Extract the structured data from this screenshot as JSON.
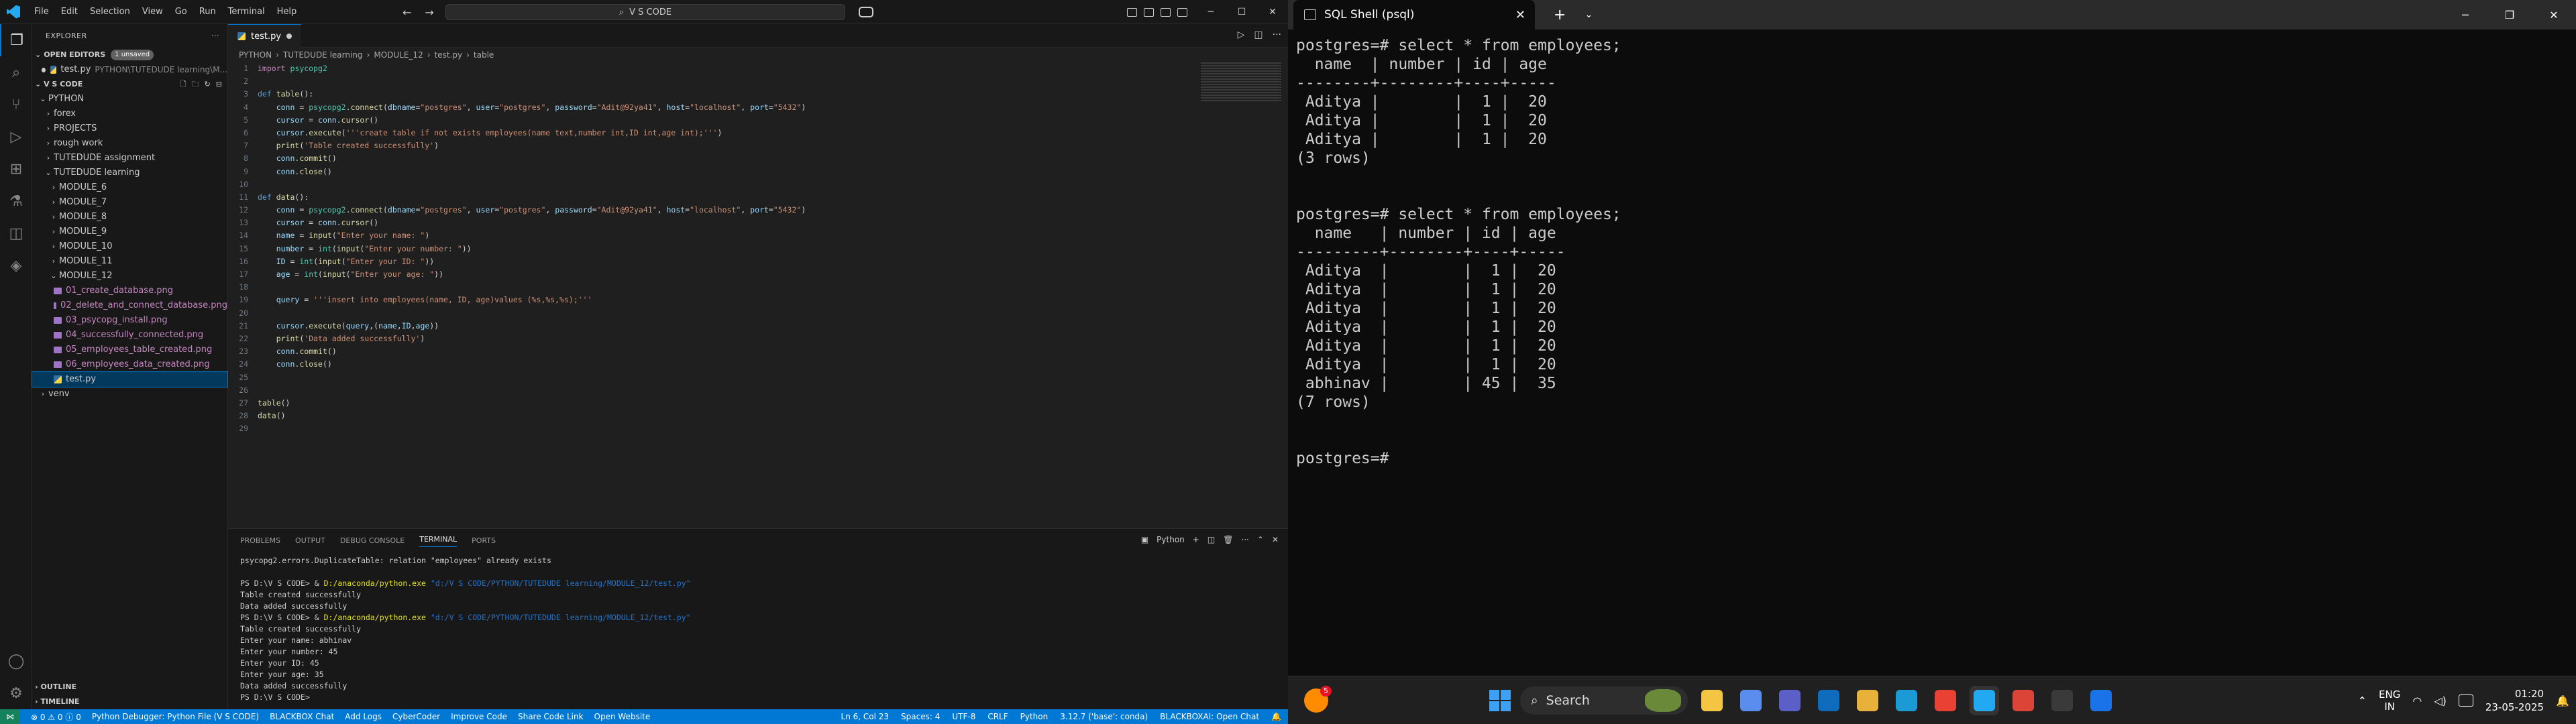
{
  "vscode": {
    "menu": [
      "File",
      "Edit",
      "Selection",
      "View",
      "Go",
      "Run",
      "Terminal",
      "Help"
    ],
    "command_center": "V S CODE",
    "explorer": {
      "title": "EXPLORER",
      "open_editors": "OPEN EDITORS",
      "unsaved_badge": "1 unsaved",
      "open_file": "test.py",
      "open_file_path": "PYTHON\\TUTEDUDE learning\\M...",
      "workspace": "V S CODE",
      "tree": [
        {
          "label": "PYTHON",
          "indent": 1,
          "type": "folder-open"
        },
        {
          "label": "forex",
          "indent": 2,
          "type": "folder"
        },
        {
          "label": "PROJECTS",
          "indent": 2,
          "type": "folder"
        },
        {
          "label": "rough work",
          "indent": 2,
          "type": "folder"
        },
        {
          "label": "TUTEDUDE assignment",
          "indent": 2,
          "type": "folder"
        },
        {
          "label": "TUTEDUDE learning",
          "indent": 2,
          "type": "folder-open"
        },
        {
          "label": "MODULE_6",
          "indent": 3,
          "type": "folder"
        },
        {
          "label": "MODULE_7",
          "indent": 3,
          "type": "folder"
        },
        {
          "label": "MODULE_8",
          "indent": 3,
          "type": "folder"
        },
        {
          "label": "MODULE_9",
          "indent": 3,
          "type": "folder"
        },
        {
          "label": "MODULE_10",
          "indent": 3,
          "type": "folder"
        },
        {
          "label": "MODULE_11",
          "indent": 3,
          "type": "folder"
        },
        {
          "label": "MODULE_12",
          "indent": 3,
          "type": "folder-open"
        },
        {
          "label": "01_create_database.png",
          "indent": 4,
          "type": "image"
        },
        {
          "label": "02_delete_and_connect_database.png",
          "indent": 4,
          "type": "image"
        },
        {
          "label": "03_psycopg_install.png",
          "indent": 4,
          "type": "image"
        },
        {
          "label": "04_successfully_connected.png",
          "indent": 4,
          "type": "image"
        },
        {
          "label": "05_employees_table_created.png",
          "indent": 4,
          "type": "image"
        },
        {
          "label": "06_employees_data_created.png",
          "indent": 4,
          "type": "image"
        },
        {
          "label": "test.py",
          "indent": 4,
          "type": "python",
          "selected": true
        },
        {
          "label": "venv",
          "indent": 1,
          "type": "folder"
        }
      ],
      "outline": "OUTLINE",
      "timeline": "TIMELINE"
    },
    "tab": "test.py",
    "breadcrumb": [
      "PYTHON",
      "TUTEDUDE learning",
      "MODULE_12",
      "test.py",
      "table"
    ],
    "code_lines": [
      [
        [
          "kw",
          "import"
        ],
        [
          "plain",
          " "
        ],
        [
          "cls",
          "psycopg2"
        ]
      ],
      [],
      [
        [
          "def",
          "def"
        ],
        [
          "plain",
          " "
        ],
        [
          "fn",
          "table"
        ],
        [
          "plain",
          "():"
        ]
      ],
      [
        [
          "plain",
          "    "
        ],
        [
          "var",
          "conn"
        ],
        [
          "plain",
          " = "
        ],
        [
          "cls",
          "psycopg2"
        ],
        [
          "plain",
          "."
        ],
        [
          "fn",
          "connect"
        ],
        [
          "plain",
          "("
        ],
        [
          "var",
          "dbname"
        ],
        [
          "plain",
          "="
        ],
        [
          "str",
          "\"postgres\""
        ],
        [
          "plain",
          ", "
        ],
        [
          "var",
          "user"
        ],
        [
          "plain",
          "="
        ],
        [
          "str",
          "\"postgres\""
        ],
        [
          "plain",
          ", "
        ],
        [
          "var",
          "password"
        ],
        [
          "plain",
          "="
        ],
        [
          "str",
          "\"Adit@92ya41\""
        ],
        [
          "plain",
          ", "
        ],
        [
          "var",
          "host"
        ],
        [
          "plain",
          "="
        ],
        [
          "str",
          "\"localhost\""
        ],
        [
          "plain",
          ", "
        ],
        [
          "var",
          "port"
        ],
        [
          "plain",
          "="
        ],
        [
          "str",
          "\"5432\""
        ],
        [
          "plain",
          ")"
        ]
      ],
      [
        [
          "plain",
          "    "
        ],
        [
          "var",
          "cursor"
        ],
        [
          "plain",
          " = "
        ],
        [
          "var",
          "conn"
        ],
        [
          "plain",
          "."
        ],
        [
          "fn",
          "cursor"
        ],
        [
          "plain",
          "()"
        ]
      ],
      [
        [
          "plain",
          "    "
        ],
        [
          "var",
          "cursor"
        ],
        [
          "plain",
          "."
        ],
        [
          "fn",
          "execute"
        ],
        [
          "plain",
          "("
        ],
        [
          "str",
          "'''create table if not exists employees(name text,number int,ID int,age int);'''"
        ],
        [
          "plain",
          ")"
        ]
      ],
      [
        [
          "plain",
          "    "
        ],
        [
          "fn",
          "print"
        ],
        [
          "plain",
          "("
        ],
        [
          "str",
          "'Table created successfully'"
        ],
        [
          "plain",
          ")"
        ]
      ],
      [
        [
          "plain",
          "    "
        ],
        [
          "var",
          "conn"
        ],
        [
          "plain",
          "."
        ],
        [
          "fn",
          "commit"
        ],
        [
          "plain",
          "()"
        ]
      ],
      [
        [
          "plain",
          "    "
        ],
        [
          "var",
          "conn"
        ],
        [
          "plain",
          "."
        ],
        [
          "fn",
          "close"
        ],
        [
          "plain",
          "()"
        ]
      ],
      [],
      [
        [
          "def",
          "def"
        ],
        [
          "plain",
          " "
        ],
        [
          "fn",
          "data"
        ],
        [
          "plain",
          "():"
        ]
      ],
      [
        [
          "plain",
          "    "
        ],
        [
          "var",
          "conn"
        ],
        [
          "plain",
          " = "
        ],
        [
          "cls",
          "psycopg2"
        ],
        [
          "plain",
          "."
        ],
        [
          "fn",
          "connect"
        ],
        [
          "plain",
          "("
        ],
        [
          "var",
          "dbname"
        ],
        [
          "plain",
          "="
        ],
        [
          "str",
          "\"postgres\""
        ],
        [
          "plain",
          ", "
        ],
        [
          "var",
          "user"
        ],
        [
          "plain",
          "="
        ],
        [
          "str",
          "\"postgres\""
        ],
        [
          "plain",
          ", "
        ],
        [
          "var",
          "password"
        ],
        [
          "plain",
          "="
        ],
        [
          "str",
          "\"Adit@92ya41\""
        ],
        [
          "plain",
          ", "
        ],
        [
          "var",
          "host"
        ],
        [
          "plain",
          "="
        ],
        [
          "str",
          "\"localhost\""
        ],
        [
          "plain",
          ", "
        ],
        [
          "var",
          "port"
        ],
        [
          "plain",
          "="
        ],
        [
          "str",
          "\"5432\""
        ],
        [
          "plain",
          ")"
        ]
      ],
      [
        [
          "plain",
          "    "
        ],
        [
          "var",
          "cursor"
        ],
        [
          "plain",
          " = "
        ],
        [
          "var",
          "conn"
        ],
        [
          "plain",
          "."
        ],
        [
          "fn",
          "cursor"
        ],
        [
          "plain",
          "()"
        ]
      ],
      [
        [
          "plain",
          "    "
        ],
        [
          "var",
          "name"
        ],
        [
          "plain",
          " = "
        ],
        [
          "fn",
          "input"
        ],
        [
          "plain",
          "("
        ],
        [
          "str",
          "\"Enter your name: \""
        ],
        [
          "plain",
          ")"
        ]
      ],
      [
        [
          "plain",
          "    "
        ],
        [
          "var",
          "number"
        ],
        [
          "plain",
          " = "
        ],
        [
          "cls",
          "int"
        ],
        [
          "plain",
          "("
        ],
        [
          "fn",
          "input"
        ],
        [
          "plain",
          "("
        ],
        [
          "str",
          "\"Enter your number: \""
        ],
        [
          "plain",
          "))"
        ]
      ],
      [
        [
          "plain",
          "    "
        ],
        [
          "var",
          "ID"
        ],
        [
          "plain",
          " = "
        ],
        [
          "cls",
          "int"
        ],
        [
          "plain",
          "("
        ],
        [
          "fn",
          "input"
        ],
        [
          "plain",
          "("
        ],
        [
          "str",
          "\"Enter your ID: \""
        ],
        [
          "plain",
          "))"
        ]
      ],
      [
        [
          "plain",
          "    "
        ],
        [
          "var",
          "age"
        ],
        [
          "plain",
          " = "
        ],
        [
          "cls",
          "int"
        ],
        [
          "plain",
          "("
        ],
        [
          "fn",
          "input"
        ],
        [
          "plain",
          "("
        ],
        [
          "str",
          "\"Enter your age: \""
        ],
        [
          "plain",
          "))"
        ]
      ],
      [],
      [
        [
          "plain",
          "    "
        ],
        [
          "var",
          "query"
        ],
        [
          "plain",
          " = "
        ],
        [
          "str",
          "'''insert into employees(name, ID, age)values (%s,%s,%s);'''"
        ]
      ],
      [],
      [
        [
          "plain",
          "    "
        ],
        [
          "var",
          "cursor"
        ],
        [
          "plain",
          "."
        ],
        [
          "fn",
          "execute"
        ],
        [
          "plain",
          "("
        ],
        [
          "var",
          "query"
        ],
        [
          "plain",
          ",("
        ],
        [
          "var",
          "name"
        ],
        [
          "plain",
          ","
        ],
        [
          "var",
          "ID"
        ],
        [
          "plain",
          ","
        ],
        [
          "var",
          "age"
        ],
        [
          "plain",
          "))"
        ]
      ],
      [
        [
          "plain",
          "    "
        ],
        [
          "fn",
          "print"
        ],
        [
          "plain",
          "("
        ],
        [
          "str",
          "'Data added successfully'"
        ],
        [
          "plain",
          ")"
        ]
      ],
      [
        [
          "plain",
          "    "
        ],
        [
          "var",
          "conn"
        ],
        [
          "plain",
          "."
        ],
        [
          "fn",
          "commit"
        ],
        [
          "plain",
          "()"
        ]
      ],
      [
        [
          "plain",
          "    "
        ],
        [
          "var",
          "conn"
        ],
        [
          "plain",
          "."
        ],
        [
          "fn",
          "close"
        ],
        [
          "plain",
          "()"
        ]
      ],
      [],
      [],
      [
        [
          "fn",
          "table"
        ],
        [
          "plain",
          "()"
        ]
      ],
      [
        [
          "fn",
          "data"
        ],
        [
          "plain",
          "()"
        ]
      ],
      []
    ],
    "panel_tabs": [
      "PROBLEMS",
      "OUTPUT",
      "DEBUG CONSOLE",
      "TERMINAL",
      "PORTS"
    ],
    "panel_active": "TERMINAL",
    "terminal_kind": "Python",
    "terminal_lines": [
      {
        "t": "psycopg2.errors.DuplicateTable: relation \"employees\" already exists"
      },
      {
        "t": ""
      },
      {
        "t": "PS D:\\V S CODE> & ",
        "y": "D:/anaconda/python.exe",
        "p": " \"d:/V S CODE/PYTHON/TUTEDUDE learning/MODULE_12/test.py\""
      },
      {
        "t": "Table created successfully"
      },
      {
        "t": "Data added successfully"
      },
      {
        "t": "PS D:\\V S CODE> & ",
        "y": "D:/anaconda/python.exe",
        "p": " \"d:/V S CODE/PYTHON/TUTEDUDE learning/MODULE_12/test.py\""
      },
      {
        "t": "Table created successfully"
      },
      {
        "t": "Enter your name: abhinav"
      },
      {
        "t": "Enter your number: 45"
      },
      {
        "t": "Enter your ID: 45"
      },
      {
        "t": "Enter your age: 35"
      },
      {
        "t": "Data added successfully"
      },
      {
        "t": "PS D:\\V S CODE> "
      }
    ],
    "status": {
      "errors": "0",
      "warnings": "0",
      "info": "0",
      "debugger": "Python Debugger: Python File (V S CODE)",
      "blackbox": "BLACKBOX Chat",
      "add_logs": "Add Logs",
      "cybercoder": "CyberCoder",
      "improve": "Improve Code",
      "share": "Share Code Link",
      "open_website": "Open Website",
      "position": "Ln 6, Col 23",
      "spaces": "Spaces: 4",
      "encoding": "UTF-8",
      "eol": "CRLF",
      "language": "Python",
      "interpreter": "3.12.7 ('base': conda)",
      "blackbox_open": "BLACKBOXAI: Open Chat"
    }
  },
  "psql": {
    "title": "SQL Shell (psql)",
    "lines": [
      "postgres=# select * from employees;",
      "  name  | number | id | age",
      "--------+--------+----+-----",
      " Aditya |        |  1 |  20",
      " Aditya |        |  1 |  20",
      " Aditya |        |  1 |  20",
      "(3 rows)",
      "",
      "",
      "postgres=# select * from employees;",
      "  name   | number | id | age",
      "---------+--------+----+-----",
      " Aditya  |        |  1 |  20",
      " Aditya  |        |  1 |  20",
      " Aditya  |        |  1 |  20",
      " Aditya  |        |  1 |  20",
      " Aditya  |        |  1 |  20",
      " Aditya  |        |  1 |  20",
      " abhinav |        | 45 |  35",
      "(7 rows)",
      "",
      "",
      "postgres=#"
    ]
  },
  "taskbar": {
    "weather_badge": "5",
    "search": "Search",
    "lang_top": "ENG",
    "lang_bottom": "IN",
    "time": "01:20",
    "date": "23-05-2025",
    "apps": [
      {
        "name": "file-explorer",
        "color": "#f4c542"
      },
      {
        "name": "copilot",
        "color": "#5b8def"
      },
      {
        "name": "teams",
        "color": "#5b5fc7"
      },
      {
        "name": "outlook",
        "color": "#0f6cbd"
      },
      {
        "name": "folder",
        "color": "#e8b13a"
      },
      {
        "name": "edge",
        "color": "#1c9ad6"
      },
      {
        "name": "chrome",
        "color": "#e94235"
      },
      {
        "name": "vscode",
        "color": "#23a9f2"
      },
      {
        "name": "chrome-profile",
        "color": "#db4437"
      },
      {
        "name": "terminal",
        "color": "#3a3a3a"
      },
      {
        "name": "blue-app",
        "color": "#1a73e8"
      }
    ]
  }
}
